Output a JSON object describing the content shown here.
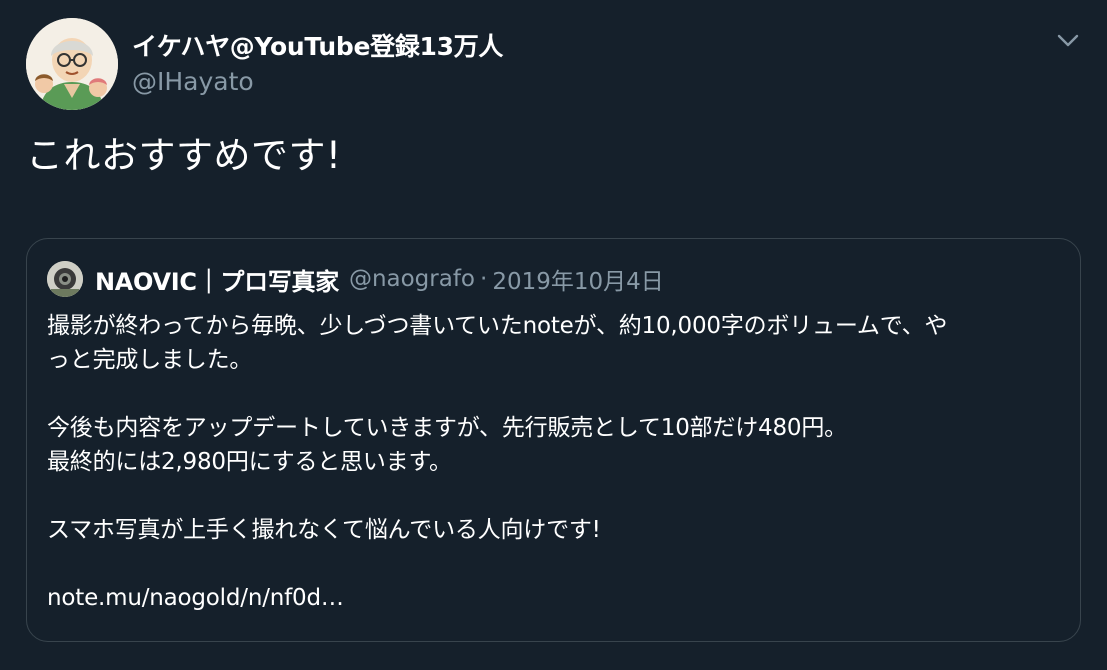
{
  "author": {
    "display_name": "イケハヤ@YouTube登録13万人",
    "handle": "@IHayato"
  },
  "tweet": {
    "text": "これおすすめです!"
  },
  "quoted_tweet": {
    "display_name": "NAOVIC｜プロ写真家",
    "handle": "@naografo",
    "separator": "·",
    "date": "2019年10月4日",
    "paragraphs": [
      [
        "撮影が終わってから毎晩、少しづつ書いていたnoteが、約10,000字のボリュームで、や",
        "っと完成しました。"
      ],
      [
        "今後も内容をアップデートしていきますが、先行販売として10部だけ480円。",
        "最終的には2,980円にすると思います。"
      ],
      [
        "スマホ写真が上手く撮れなくて悩んでいる人向けです!"
      ],
      [
        "note.mu/naogold/n/nf0d…"
      ]
    ]
  },
  "colors": {
    "background": "#15202b",
    "text_primary": "#ffffff",
    "text_secondary": "#8899a6",
    "border": "#38444d"
  },
  "icons": {
    "menu": "chevron-down-icon"
  }
}
